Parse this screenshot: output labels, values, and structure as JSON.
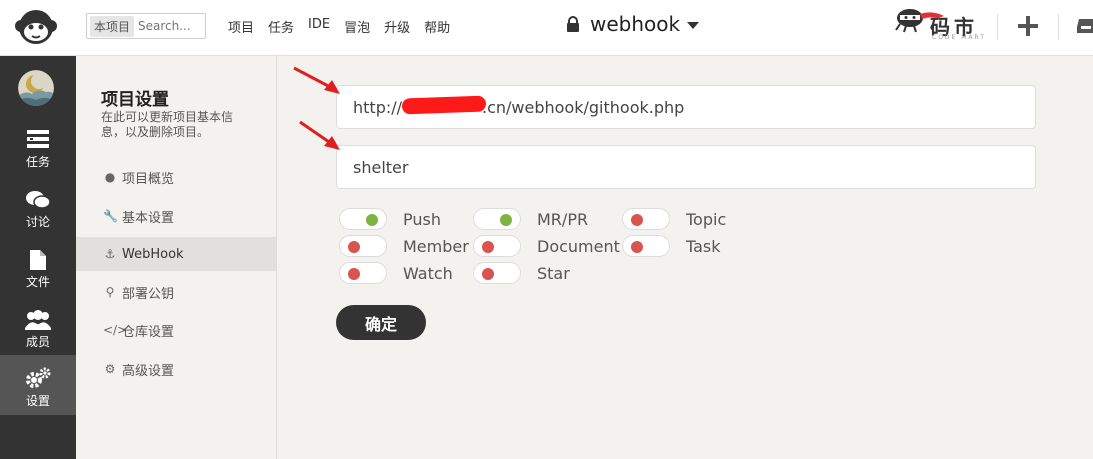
{
  "topbar": {
    "search_scope": "本项目",
    "search_placeholder": "Search...",
    "nav": [
      "项目",
      "任务",
      "IDE",
      "冒泡",
      "升级",
      "帮助"
    ],
    "project_name": "webhook",
    "brand_text": "码市",
    "brand_sub": "CODE MART"
  },
  "sidebar": {
    "items": [
      {
        "label": "任务",
        "icon": "tasks-icon"
      },
      {
        "label": "讨论",
        "icon": "chat-bubble-icon"
      },
      {
        "label": "文件",
        "icon": "file-icon"
      },
      {
        "label": "成员",
        "icon": "members-icon"
      },
      {
        "label": "设置",
        "icon": "gear-icon"
      }
    ],
    "active": "设置"
  },
  "settings_nav": {
    "title": "项目设置",
    "description": "在此可以更新项目基本信息，以及删除项目。",
    "items": [
      {
        "label": "项目概览",
        "icon": "info-icon"
      },
      {
        "label": "基本设置",
        "icon": "wrench-icon"
      },
      {
        "label": "WebHook",
        "icon": "anchor-icon"
      },
      {
        "label": "部署公钥",
        "icon": "key-icon"
      },
      {
        "label": "仓库设置",
        "icon": "code-icon"
      },
      {
        "label": "高级设置",
        "icon": "gear-icon"
      }
    ],
    "active": "WebHook"
  },
  "webhook": {
    "url_prefix": "http://",
    "url_suffix": ".cn/webhook/githook.php",
    "token": "shelter",
    "events": [
      {
        "label": "Push",
        "enabled": true
      },
      {
        "label": "MR/PR",
        "enabled": true
      },
      {
        "label": "Topic",
        "enabled": false
      },
      {
        "label": "Member",
        "enabled": false
      },
      {
        "label": "Document",
        "enabled": false
      },
      {
        "label": "Task",
        "enabled": false
      },
      {
        "label": "Watch",
        "enabled": false
      },
      {
        "label": "Star",
        "enabled": false
      }
    ],
    "confirm_label": "确定"
  },
  "colors": {
    "toggle_on": "#7cb342",
    "toggle_off": "#d9534f",
    "sidebar_bg": "#333333",
    "annotation_arrow": "#e02020"
  }
}
